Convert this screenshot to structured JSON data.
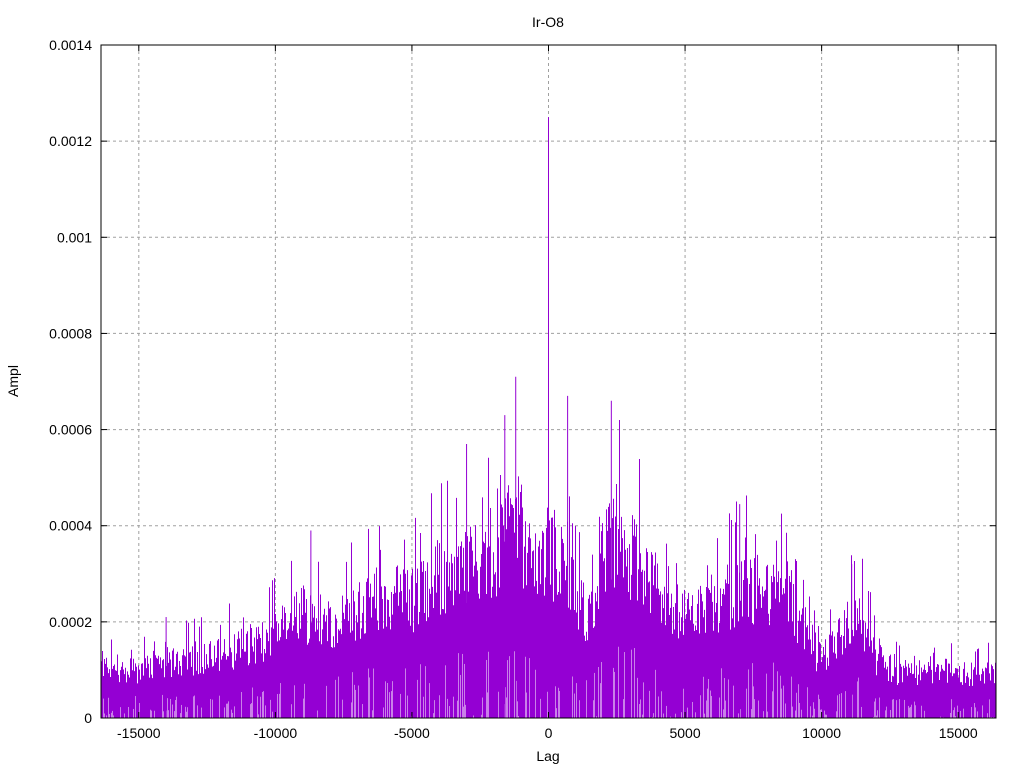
{
  "chart_data": {
    "type": "bar",
    "style": "impulses",
    "title": "Ir-O8",
    "xlabel": "Lag",
    "ylabel": "Ampl",
    "xlim": [
      -16384,
      16384
    ],
    "ylim": [
      0,
      0.0014
    ],
    "grid": true,
    "color": "#9400D3",
    "xticks": [
      -15000,
      -10000,
      -5000,
      0,
      5000,
      10000,
      15000
    ],
    "xtick_labels": [
      "-15000",
      "-10000",
      "-5000",
      "0",
      "5000",
      "10000",
      "15000"
    ],
    "yticks": [
      0,
      0.0002,
      0.0004,
      0.0006,
      0.0008,
      0.001,
      0.0012,
      0.0014
    ],
    "ytick_labels": [
      "0",
      "0.0002",
      "0.0004",
      "0.0006",
      "0.0008",
      "0.001",
      "0.0012",
      "0.0014"
    ],
    "envelope": {
      "x": [
        -16384,
        -15000,
        -14000,
        -12000,
        -10000,
        -9000,
        -8000,
        -7000,
        -6000,
        -5000,
        -4000,
        -3000,
        -2000,
        -1500,
        -1000,
        -500,
        0,
        500,
        1000,
        1500,
        2000,
        2500,
        3000,
        4000,
        5000,
        6000,
        7000,
        8000,
        8500,
        9500,
        10000,
        11000,
        11500,
        12000,
        13000,
        14000,
        15000,
        16384
      ],
      "y": [
        0.00014,
        0.00013,
        0.00015,
        0.00017,
        0.00022,
        0.00028,
        0.00026,
        0.00029,
        0.00033,
        0.00032,
        0.00038,
        0.00042,
        0.0004,
        0.00052,
        0.0005,
        0.0004,
        0.00045,
        0.00042,
        0.00032,
        0.00026,
        0.00042,
        0.0005,
        0.00044,
        0.00034,
        0.00028,
        0.0003,
        0.00035,
        0.00035,
        0.00034,
        0.00022,
        0.00015,
        0.00026,
        0.00025,
        0.00016,
        0.00011,
        0.00013,
        0.00012,
        0.00012
      ]
    },
    "peaks": [
      {
        "x": 0,
        "y": 0.00125
      },
      {
        "x": -1200,
        "y": 0.00071
      },
      {
        "x": 700,
        "y": 0.00067
      },
      {
        "x": 2300,
        "y": 0.00066
      },
      {
        "x": -1600,
        "y": 0.00063
      },
      {
        "x": -3000,
        "y": 0.00057
      },
      {
        "x": 7000,
        "y": 0.000445
      },
      {
        "x": -8700,
        "y": 0.00039
      },
      {
        "x": 11100,
        "y": 0.00032
      },
      {
        "x": -14000,
        "y": 0.00021
      }
    ]
  }
}
